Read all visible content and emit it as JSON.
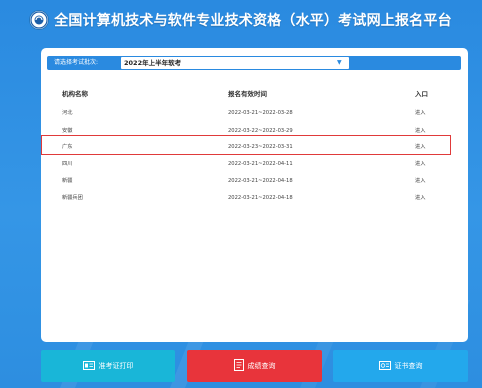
{
  "header": {
    "title": "全国计算机技术与软件专业技术资格（水平）考试网上报名平台"
  },
  "selector": {
    "label": "请选择考试批次:",
    "value": "2022年上半年软考"
  },
  "table": {
    "headers": [
      "机构名称",
      "报名有效时间",
      "入口"
    ],
    "rows": [
      {
        "name": "河北",
        "period": "2022-03-21~2022-03-28",
        "entry": "进入"
      },
      {
        "name": "安徽",
        "period": "2022-03-22~2022-03-29",
        "entry": "进入"
      },
      {
        "name": "广东",
        "period": "2022-03-23~2022-03-31",
        "entry": "进入"
      },
      {
        "name": "四川",
        "period": "2022-03-21~2022-04-11",
        "entry": "进入"
      },
      {
        "name": "新疆",
        "period": "2022-03-21~2022-04-18",
        "entry": "进入"
      },
      {
        "name": "新疆兵团",
        "period": "2022-03-21~2022-04-18",
        "entry": "进入"
      }
    ],
    "highlighted_row": "广东"
  },
  "buttons": {
    "admission": {
      "label": "准考证打印",
      "icon": "id-card-icon"
    },
    "score": {
      "label": "成绩查询",
      "icon": "document-icon"
    },
    "certificate": {
      "label": "证书查询",
      "icon": "certificate-icon"
    }
  },
  "colors": {
    "background": "#2d8ee0",
    "selector_bar": "#2a8ae0",
    "highlight": "#e03a3a",
    "btn_admission": "#19b6d8",
    "btn_score": "#e8343b",
    "btn_certificate": "#23a8ec"
  }
}
